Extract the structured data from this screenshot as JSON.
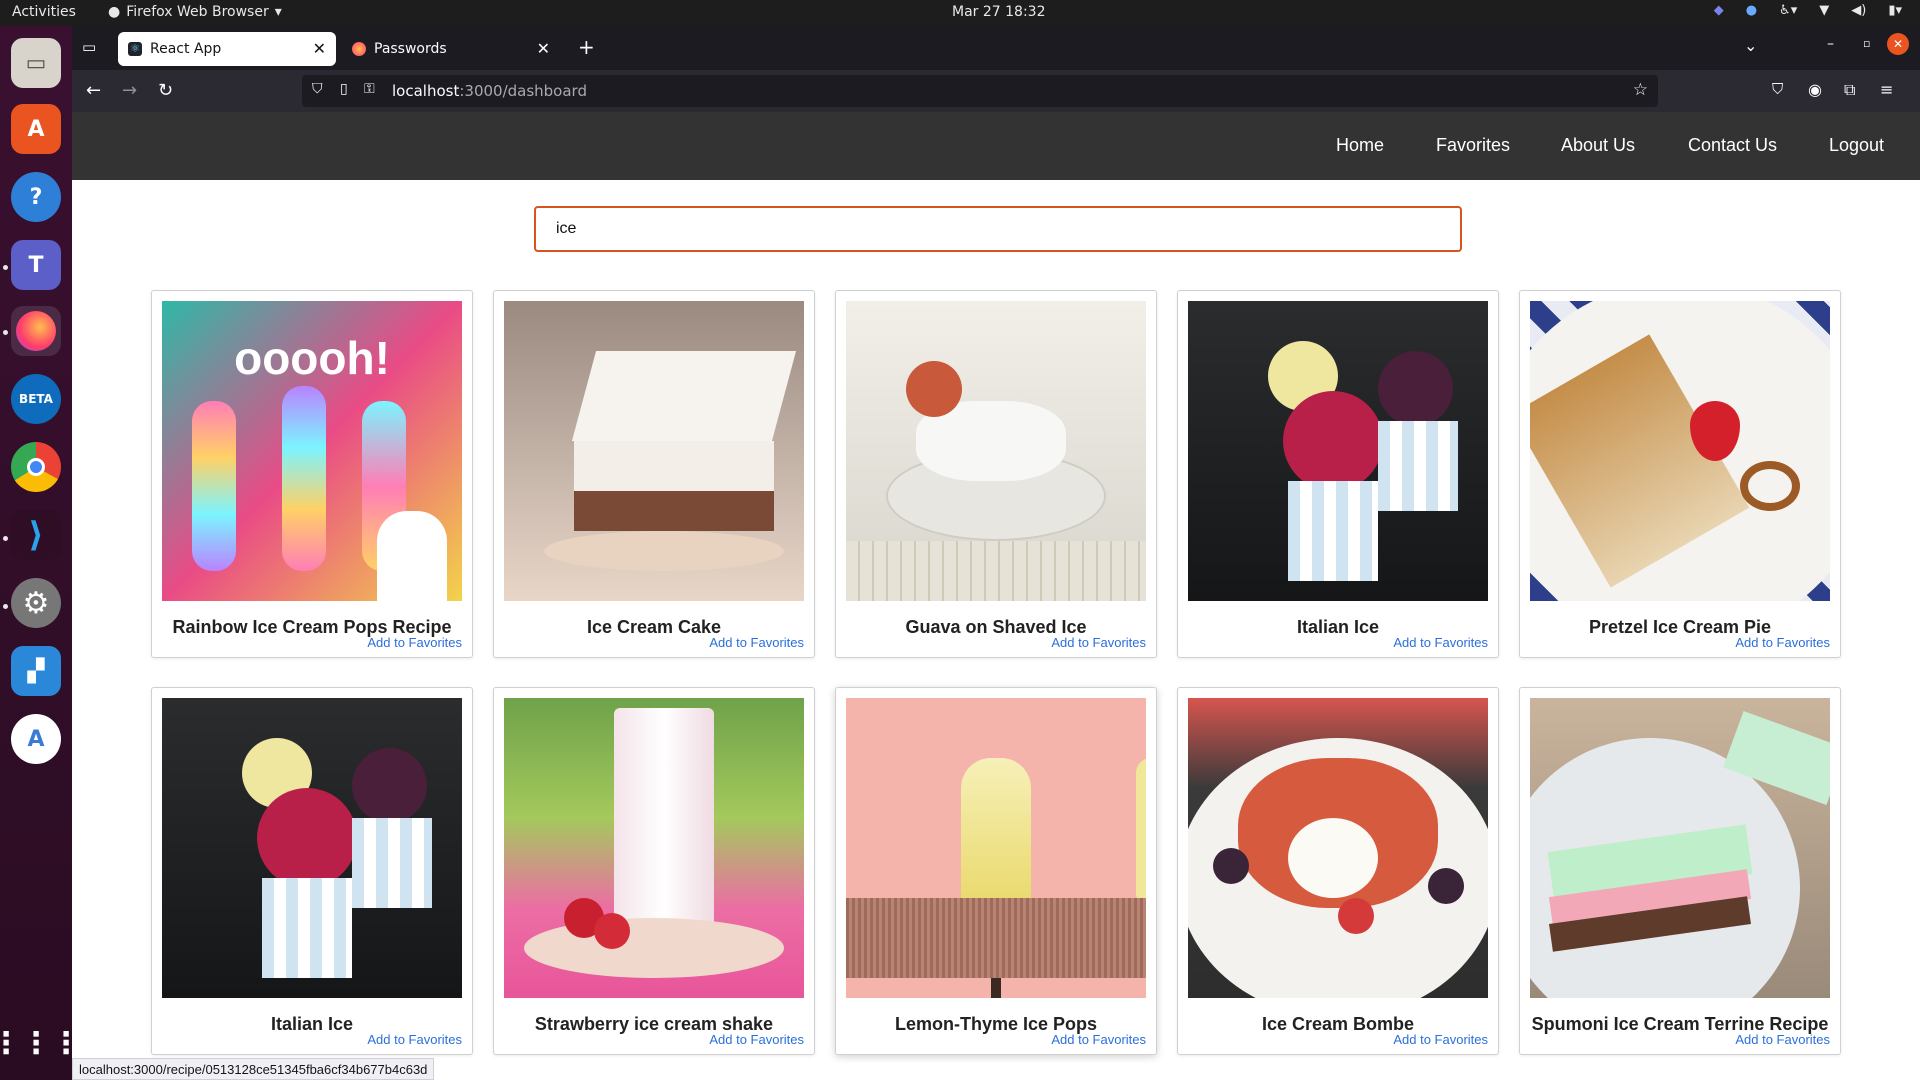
{
  "system": {
    "activities": "Activities",
    "app_menu": "Firefox Web Browser",
    "clock": "Mar 27  18:32"
  },
  "browser": {
    "tabs": [
      {
        "label": "React App",
        "active": true
      },
      {
        "label": "Passwords",
        "active": false
      }
    ],
    "url_host": "localhost",
    "url_rest": ":3000/dashboard",
    "status_url": "localhost:3000/recipe/0513128ce51345fba6cf34b677b4c63d"
  },
  "app": {
    "nav": [
      "Home",
      "Favorites",
      "About Us",
      "Contact Us",
      "Logout"
    ],
    "search_value": "ice",
    "favorite_label": "Add to Favorites",
    "recipes": [
      {
        "title": "Rainbow Ice Cream Pops Recipe",
        "image": "rainbow-popsicles"
      },
      {
        "title": "Ice Cream Cake",
        "image": "ice-cream-cake-slice"
      },
      {
        "title": "Guava on Shaved Ice",
        "image": "guava-shaved-ice"
      },
      {
        "title": "Italian Ice",
        "image": "italian-ice-cups"
      },
      {
        "title": "Pretzel Ice Cream Pie",
        "image": "pretzel-pie-plate"
      },
      {
        "title": "Italian Ice",
        "image": "italian-ice-cups"
      },
      {
        "title": "Strawberry ice cream shake",
        "image": "strawberry-shake"
      },
      {
        "title": "Lemon-Thyme Ice Pops",
        "image": "lemon-pops"
      },
      {
        "title": "Ice Cream Bombe",
        "image": "ice-cream-bombe"
      },
      {
        "title": "Spumoni Ice Cream Terrine Recipe",
        "image": "spumoni-terrine"
      }
    ]
  }
}
